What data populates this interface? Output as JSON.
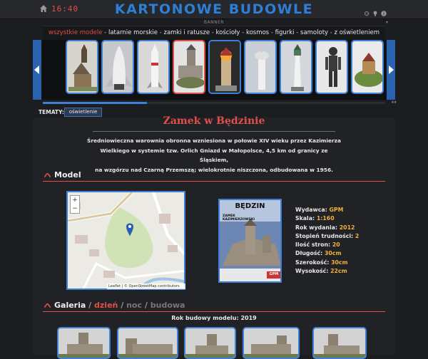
{
  "header": {
    "time": "16:40",
    "title": "KARTONOWE BUDOWLE",
    "banner_label": "BANNER"
  },
  "categories": [
    {
      "label": "wszystkie modele",
      "active": true
    },
    {
      "label": "latarnie morskie",
      "active": false
    },
    {
      "label": "zamki i ratusze",
      "active": false
    },
    {
      "label": "kościoły",
      "active": false
    },
    {
      "label": "kosmos",
      "active": false
    },
    {
      "label": "figurki",
      "active": false
    },
    {
      "label": "samoloty",
      "active": false
    },
    {
      "label": "z oświetleniem",
      "active": false
    }
  ],
  "carousel": {
    "thumbnails": [
      {
        "name": "wooden-church-thumb",
        "selected": false
      },
      {
        "name": "space-shuttle-thumb",
        "selected": false
      },
      {
        "name": "rocket-thumb",
        "selected": false
      },
      {
        "name": "castle-thumb",
        "selected": true
      },
      {
        "name": "lighthouse-lit-thumb",
        "selected": false
      },
      {
        "name": "tower-thumb",
        "selected": false
      },
      {
        "name": "lighthouse-thumb",
        "selected": false
      },
      {
        "name": "predator-figure-thumb",
        "selected": false
      },
      {
        "name": "castle-hill-thumb",
        "selected": false
      }
    ]
  },
  "tematy": {
    "label": "TEMATY:",
    "tag": "oświetlenie"
  },
  "page": {
    "title": "Zamek w Będzinie",
    "description_lines": [
      "Średniowieczna warownia obronna wzniesiona w połowie XIV wieku przez Kazimierza",
      "Wielkiego w systemie tzw. Orlich Gniazd w Małopolsce, 4,5 km od granicy ze Śląskiem,",
      "na wzgórzu nad Czarną Przemszą; wielokrotnie niszczona, odbudowana w 1956."
    ]
  },
  "model_section": {
    "title": "Model",
    "map": {
      "zoom_in": "+",
      "zoom_out": "−",
      "attribution": "Leaflet | © OpenStreetMap contributors"
    },
    "cover": {
      "title": "BĘDZIN",
      "subtitle": "ZAMEK KAZIMIERZOWSKI",
      "publisher_badge": "GPM"
    },
    "specs": [
      {
        "label": "Wydawca:",
        "value": "GPM"
      },
      {
        "label": "Skala:",
        "value": "1:160"
      },
      {
        "label": "Rok wydania:",
        "value": "2012"
      },
      {
        "label": "Stopień trudności:",
        "value": "2"
      },
      {
        "label": "Ilość stron:",
        "value": "20"
      },
      {
        "label": "Długość:",
        "value": "30cm"
      },
      {
        "label": "Szerokość:",
        "value": "30cm"
      },
      {
        "label": "Wysokość:",
        "value": "22cm"
      }
    ]
  },
  "gallery_section": {
    "title": "Galeria",
    "sep": "/",
    "tab_day": "dzień",
    "tab_night": "noc",
    "tab_construction": "budowa",
    "build_year": "Rok budowy modelu: 2019"
  },
  "colors": {
    "accent": "#e0504a",
    "brand_blue": "#2d7fd6",
    "value_gold": "#f0b23a"
  }
}
